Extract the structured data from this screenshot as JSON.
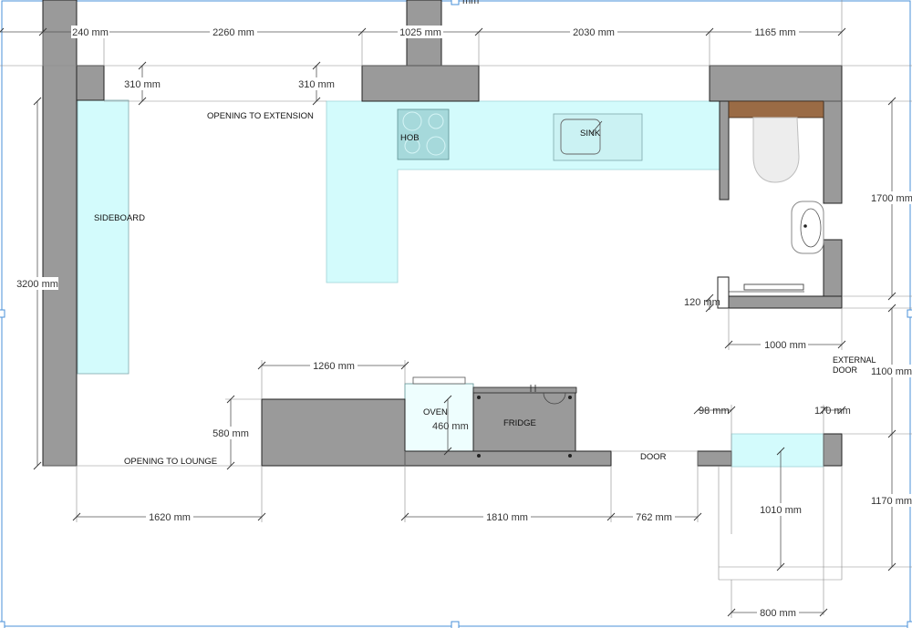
{
  "colors": {
    "wall": "#9a9a9a",
    "wall_stroke": "#222222",
    "counter": "#d3fbfc",
    "counter_stroke": "#9fd2d6",
    "selection": "#4a90d9",
    "wood": "#9a6b45"
  },
  "dimensions": {
    "top_240": "240 mm",
    "top_2260": "2260 mm",
    "top_1025": "1025 mm",
    "top_2030": "2030 mm",
    "top_1165": "1165 mm",
    "top_cut": "mm",
    "left_310": "310 mm",
    "mid_310": "310 mm",
    "left_3200": "3200 mm",
    "right_1700": "1700 mm",
    "right_120": "120 mm",
    "right_1000": "1000 mm",
    "right_1100": "1100 mm",
    "bottom_1260": "1260 mm",
    "bottom_580": "580 mm",
    "bottom_460": "460 mm",
    "bottom_1620": "1620 mm",
    "bottom_1810": "1810 mm",
    "bottom_762": "762 mm",
    "door_98": "98 mm",
    "door_170": "170 mm",
    "door_1010": "1010 mm",
    "door_1170": "1170 mm",
    "door_800": "800 mm"
  },
  "labels": {
    "opening_extension": "OPENING TO EXTENSION",
    "hob": "HOB",
    "sink": "SINK",
    "sideboard": "SIDEBOARD",
    "oven": "OVEN",
    "fridge": "FRIDGE",
    "opening_lounge": "OPENING TO LOUNGE",
    "door": "DOOR",
    "external_door_line1": "EXTERNAL",
    "external_door_line2": "DOOR"
  }
}
